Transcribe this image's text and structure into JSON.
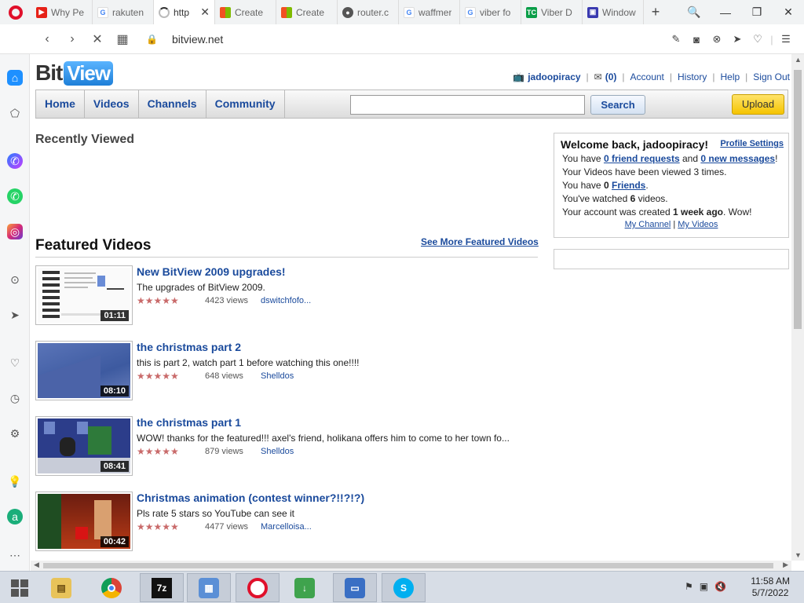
{
  "browser": {
    "tabs": [
      {
        "label": "Why Pe",
        "fav_color": "#e62117",
        "fav_glyph": "▶"
      },
      {
        "label": "rakuten",
        "fav_color": "#4285f4",
        "fav_glyph": "G"
      },
      {
        "label": "http",
        "fav_color": "#aaaaaa",
        "fav_glyph": "◌",
        "active": true
      },
      {
        "label": "Create",
        "fav_color": "#f25022",
        "fav_glyph": "■"
      },
      {
        "label": "Create",
        "fav_color": "#f25022",
        "fav_glyph": "■"
      },
      {
        "label": "router.c",
        "fav_color": "#555555",
        "fav_glyph": "●"
      },
      {
        "label": "waffmer",
        "fav_color": "#4285f4",
        "fav_glyph": "G"
      },
      {
        "label": "viber fo",
        "fav_color": "#4285f4",
        "fav_glyph": "G"
      },
      {
        "label": "Viber D",
        "fav_color": "#0a9e48",
        "fav_glyph": "TC"
      },
      {
        "label": "Window",
        "fav_color": "#3a3ab0",
        "fav_glyph": "▣"
      }
    ],
    "url": "bitview.net",
    "window_controls": {
      "search": "🔍",
      "minimize": "—",
      "restore": "❐",
      "close": "✕"
    }
  },
  "site": {
    "logo_bit": "Bit",
    "logo_view": "View",
    "user": {
      "username": "jadoopiracy",
      "messages_count": "(0)",
      "links": [
        "Account",
        "History",
        "Help",
        "Sign Out"
      ]
    },
    "nav": [
      "Home",
      "Videos",
      "Channels",
      "Community"
    ],
    "search_button": "Search",
    "upload_button": "Upload",
    "recently_viewed_title": "Recently Viewed",
    "featured": {
      "title": "Featured Videos",
      "more_link": "See More Featured Videos",
      "videos": [
        {
          "title": "New BitView 2009 upgrades!",
          "description": "The upgrades of BitView 2009.",
          "views": "4423 views",
          "user": "dswitchfofo...",
          "duration": "01:11",
          "rating": 4.5,
          "stars": "★★★★★"
        },
        {
          "title": "the christmas part 2",
          "description": "this is part 2, watch part 1 before watching this one!!!!",
          "views": "648 views",
          "user": "Shelldos",
          "duration": "08:10",
          "rating": 4.5,
          "stars": "★★★★★"
        },
        {
          "title": "the christmas part 1",
          "description": "WOW! thanks for the featured!!! axel's friend, holikana offers him to come to her town fo...",
          "views": "879 views",
          "user": "Shelldos",
          "duration": "08:41",
          "rating": 4.5,
          "stars": "★★★★★"
        },
        {
          "title": "Christmas animation (contest winner?!!?!?)",
          "description": "Pls rate 5 stars so YouTube can see it",
          "views": "4477 views",
          "user": "Marcelloisa...",
          "duration": "00:42",
          "rating": 4.5,
          "stars": "★★★★★"
        }
      ]
    },
    "welcome": {
      "heading": "Welcome back, jadoopiracy!",
      "profile_settings": "Profile Settings",
      "line1_prefix": "You have ",
      "friend_requests": "0 friend requests",
      "line1_mid": " and ",
      "new_messages": "0 new messages",
      "line1_suffix": "!",
      "line2_prefix": "Your Videos have been viewed ",
      "view_count": "3",
      "line2_suffix": " times.",
      "line3_prefix": "You have ",
      "friends_count": "0",
      "friends_link": "Friends",
      "line3_suffix": ".",
      "line4_prefix": "You've watched ",
      "watched_count": "6",
      "line4_suffix": " videos.",
      "line5_prefix": "Your account was created ",
      "created_ago": "1 week ago",
      "line5_suffix": ". Wow!",
      "my_channel": "My Channel",
      "my_videos": "My Videos",
      "link_sep": "|"
    }
  },
  "taskbar": {
    "time": "11:58 AM",
    "date": "5/7/2022"
  }
}
